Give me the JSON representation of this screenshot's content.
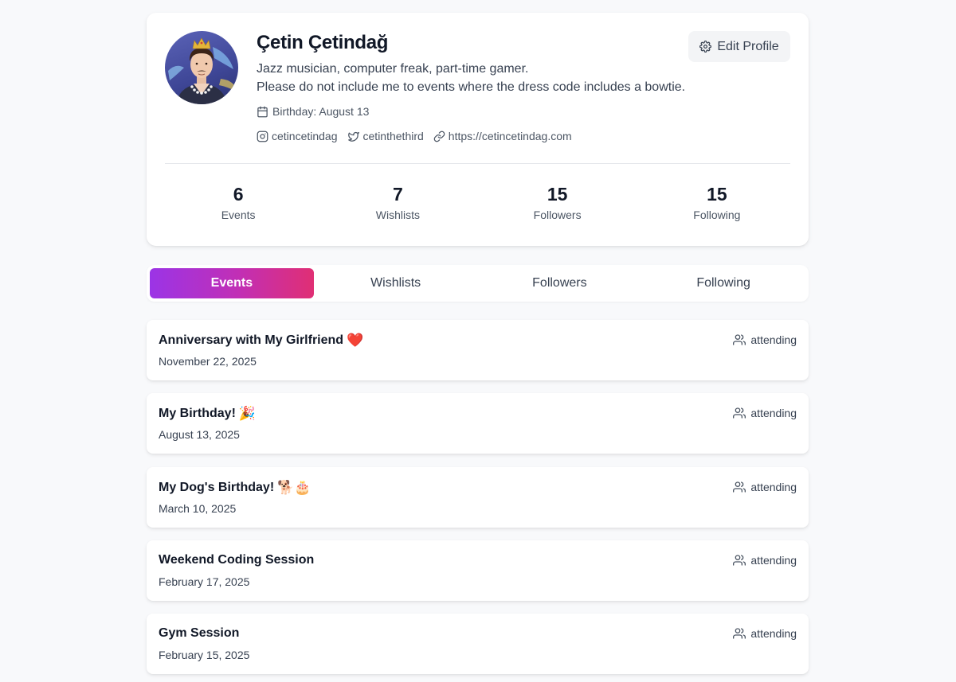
{
  "profile": {
    "name": "Çetin Çetindağ",
    "bio_line1": "Jazz musician, computer freak, part-time gamer.",
    "bio_line2": "Please do not include me to events where the dress code includes a bowtie.",
    "birthday": "Birthday: August 13",
    "instagram": "cetincetindag",
    "twitter": "cetinthethird",
    "website": "https://cetincetindag.com",
    "edit_label": "Edit Profile"
  },
  "stats": [
    {
      "value": "6",
      "label": "Events"
    },
    {
      "value": "7",
      "label": "Wishlists"
    },
    {
      "value": "15",
      "label": "Followers"
    },
    {
      "value": "15",
      "label": "Following"
    }
  ],
  "tabs": [
    {
      "label": "Events",
      "active": true
    },
    {
      "label": "Wishlists",
      "active": false
    },
    {
      "label": "Followers",
      "active": false
    },
    {
      "label": "Following",
      "active": false
    }
  ],
  "events": [
    {
      "title": "Anniversary with My Girlfriend",
      "emoji": "❤️",
      "date": "November 22, 2025",
      "status": "attending"
    },
    {
      "title": "My Birthday!",
      "emoji": "🎉",
      "date": "August 13, 2025",
      "status": "attending"
    },
    {
      "title": "My Dog's Birthday!",
      "emoji": "🐕🎂",
      "date": "March 10, 2025",
      "status": "attending"
    },
    {
      "title": "Weekend Coding Session",
      "emoji": "",
      "date": "February 17, 2025",
      "status": "attending"
    },
    {
      "title": "Gym Session",
      "emoji": "",
      "date": "February 15, 2025",
      "status": "attending"
    }
  ],
  "colors": {
    "tab_active_gradient_start": "#9b34e6",
    "tab_active_gradient_end": "#e02f74",
    "background": "#f8f9fb"
  }
}
